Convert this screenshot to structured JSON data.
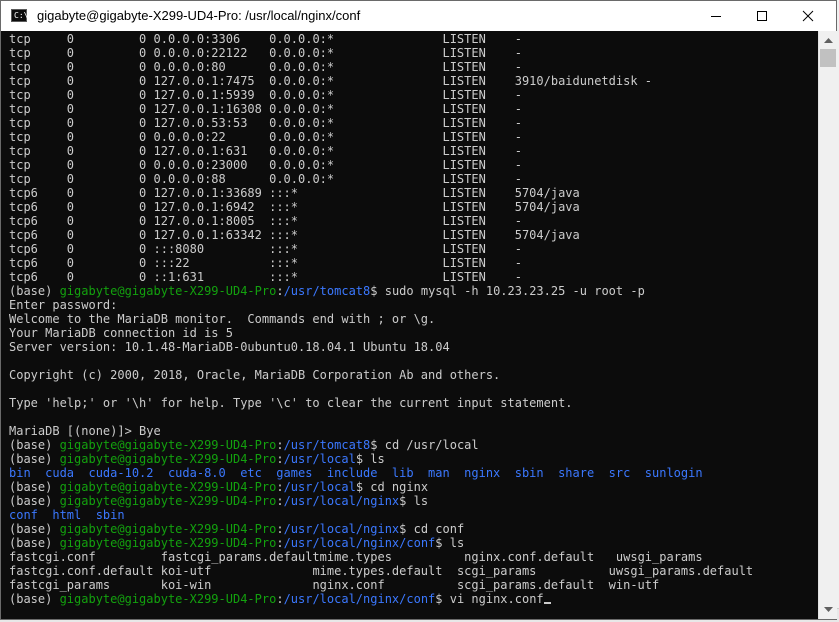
{
  "window": {
    "title": "gigabyte@gigabyte-X299-UD4-Pro: /usr/local/nginx/conf",
    "icon_name": "console-icon",
    "icon_glyph": "C:\\"
  },
  "colors": {
    "background": "#0c0c0c",
    "text": "#cccccc",
    "prompt_user": "#13a10e",
    "path": "#3b78ff"
  },
  "netstat": [
    [
      "tcp",
      "0",
      "0 0.0.0.0:3306",
      "0.0.0.0:*",
      "LISTEN",
      "-"
    ],
    [
      "tcp",
      "0",
      "0 0.0.0.0:22122",
      "0.0.0.0:*",
      "LISTEN",
      "-"
    ],
    [
      "tcp",
      "0",
      "0 0.0.0.0:80",
      "0.0.0.0:*",
      "LISTEN",
      "-"
    ],
    [
      "tcp",
      "0",
      "0 127.0.0.1:7475",
      "0.0.0.0:*",
      "LISTEN",
      "3910/baidunetdisk -"
    ],
    [
      "tcp",
      "0",
      "0 127.0.0.1:5939",
      "0.0.0.0:*",
      "LISTEN",
      "-"
    ],
    [
      "tcp",
      "0",
      "0 127.0.0.1:16308",
      "0.0.0.0:*",
      "LISTEN",
      "-"
    ],
    [
      "tcp",
      "0",
      "0 127.0.0.53:53",
      "0.0.0.0:*",
      "LISTEN",
      "-"
    ],
    [
      "tcp",
      "0",
      "0 0.0.0.0:22",
      "0.0.0.0:*",
      "LISTEN",
      "-"
    ],
    [
      "tcp",
      "0",
      "0 127.0.0.1:631",
      "0.0.0.0:*",
      "LISTEN",
      "-"
    ],
    [
      "tcp",
      "0",
      "0 0.0.0.0:23000",
      "0.0.0.0:*",
      "LISTEN",
      "-"
    ],
    [
      "tcp",
      "0",
      "0 0.0.0.0:88",
      "0.0.0.0:*",
      "LISTEN",
      "-"
    ],
    [
      "tcp6",
      "0",
      "0 127.0.0.1:33689",
      ":::*",
      "LISTEN",
      "5704/java"
    ],
    [
      "tcp6",
      "0",
      "0 127.0.0.1:6942",
      ":::*",
      "LISTEN",
      "5704/java"
    ],
    [
      "tcp6",
      "0",
      "0 127.0.0.1:8005",
      ":::*",
      "LISTEN",
      "-"
    ],
    [
      "tcp6",
      "0",
      "0 127.0.0.1:63342",
      ":::*",
      "LISTEN",
      "5704/java"
    ],
    [
      "tcp6",
      "0",
      "0 :::8080",
      ":::*",
      "LISTEN",
      "-"
    ],
    [
      "tcp6",
      "0",
      "0 :::22",
      ":::*",
      "LISTEN",
      "-"
    ],
    [
      "tcp6",
      "0",
      "0 ::1:631",
      ":::*",
      "LISTEN",
      "-"
    ]
  ],
  "session": [
    {
      "kind": "prompt",
      "env": "(base) ",
      "user": "gigabyte@gigabyte-X299-UD4-Pro",
      "path": "/usr/tomcat8",
      "cmd": "$ sudo mysql -h 10.23.23.25 -u root -p"
    },
    {
      "kind": "text",
      "text": "Enter password:"
    },
    {
      "kind": "text",
      "text": "Welcome to the MariaDB monitor.  Commands end with ; or \\g."
    },
    {
      "kind": "text",
      "text": "Your MariaDB connection id is 5"
    },
    {
      "kind": "text",
      "text": "Server version: 10.1.48-MariaDB-0ubuntu0.18.04.1 Ubuntu 18.04"
    },
    {
      "kind": "text",
      "text": ""
    },
    {
      "kind": "text",
      "text": "Copyright (c) 2000, 2018, Oracle, MariaDB Corporation Ab and others."
    },
    {
      "kind": "text",
      "text": ""
    },
    {
      "kind": "text",
      "text": "Type 'help;' or '\\h' for help. Type '\\c' to clear the current input statement."
    },
    {
      "kind": "text",
      "text": ""
    },
    {
      "kind": "text",
      "text": "MariaDB [(none)]> Bye"
    },
    {
      "kind": "prompt",
      "env": "(base) ",
      "user": "gigabyte@gigabyte-X299-UD4-Pro",
      "path": "/usr/tomcat8",
      "cmd": "$ cd /usr/local"
    },
    {
      "kind": "prompt",
      "env": "(base) ",
      "user": "gigabyte@gigabyte-X299-UD4-Pro",
      "path": "/usr/local",
      "cmd": "$ ls"
    },
    {
      "kind": "dirs",
      "text": "bin  cuda  cuda-10.2  cuda-8.0  etc  games  include  lib  man  nginx  sbin  share  src  sunlogin"
    },
    {
      "kind": "prompt",
      "env": "(base) ",
      "user": "gigabyte@gigabyte-X299-UD4-Pro",
      "path": "/usr/local",
      "cmd": "$ cd nginx"
    },
    {
      "kind": "prompt",
      "env": "(base) ",
      "user": "gigabyte@gigabyte-X299-UD4-Pro",
      "path": "/usr/local/nginx",
      "cmd": "$ ls"
    },
    {
      "kind": "dirs",
      "text": "conf  html  sbin"
    },
    {
      "kind": "prompt",
      "env": "(base) ",
      "user": "gigabyte@gigabyte-X299-UD4-Pro",
      "path": "/usr/local/nginx",
      "cmd": "$ cd conf"
    },
    {
      "kind": "prompt",
      "env": "(base) ",
      "user": "gigabyte@gigabyte-X299-UD4-Pro",
      "path": "/usr/local/nginx/conf",
      "cmd": "$ ls"
    },
    {
      "kind": "files",
      "cells": [
        "fastcgi.conf",
        "fastcgi_params.default",
        "mime.types",
        "nginx.conf.default",
        "uwsgi_params"
      ]
    },
    {
      "kind": "files",
      "cells": [
        "fastcgi.conf.default",
        "koi-utf",
        "mime.types.default",
        "scgi_params",
        "uwsgi_params.default"
      ]
    },
    {
      "kind": "files",
      "cells": [
        "fastcgi_params",
        "koi-win",
        "nginx.conf",
        "scgi_params.default",
        "win-utf"
      ]
    },
    {
      "kind": "prompt",
      "env": "(base) ",
      "user": "gigabyte@gigabyte-X299-UD4-Pro",
      "path": "/usr/local/nginx/conf",
      "cmd": "$ vi nginx.conf",
      "cursor": true
    }
  ]
}
